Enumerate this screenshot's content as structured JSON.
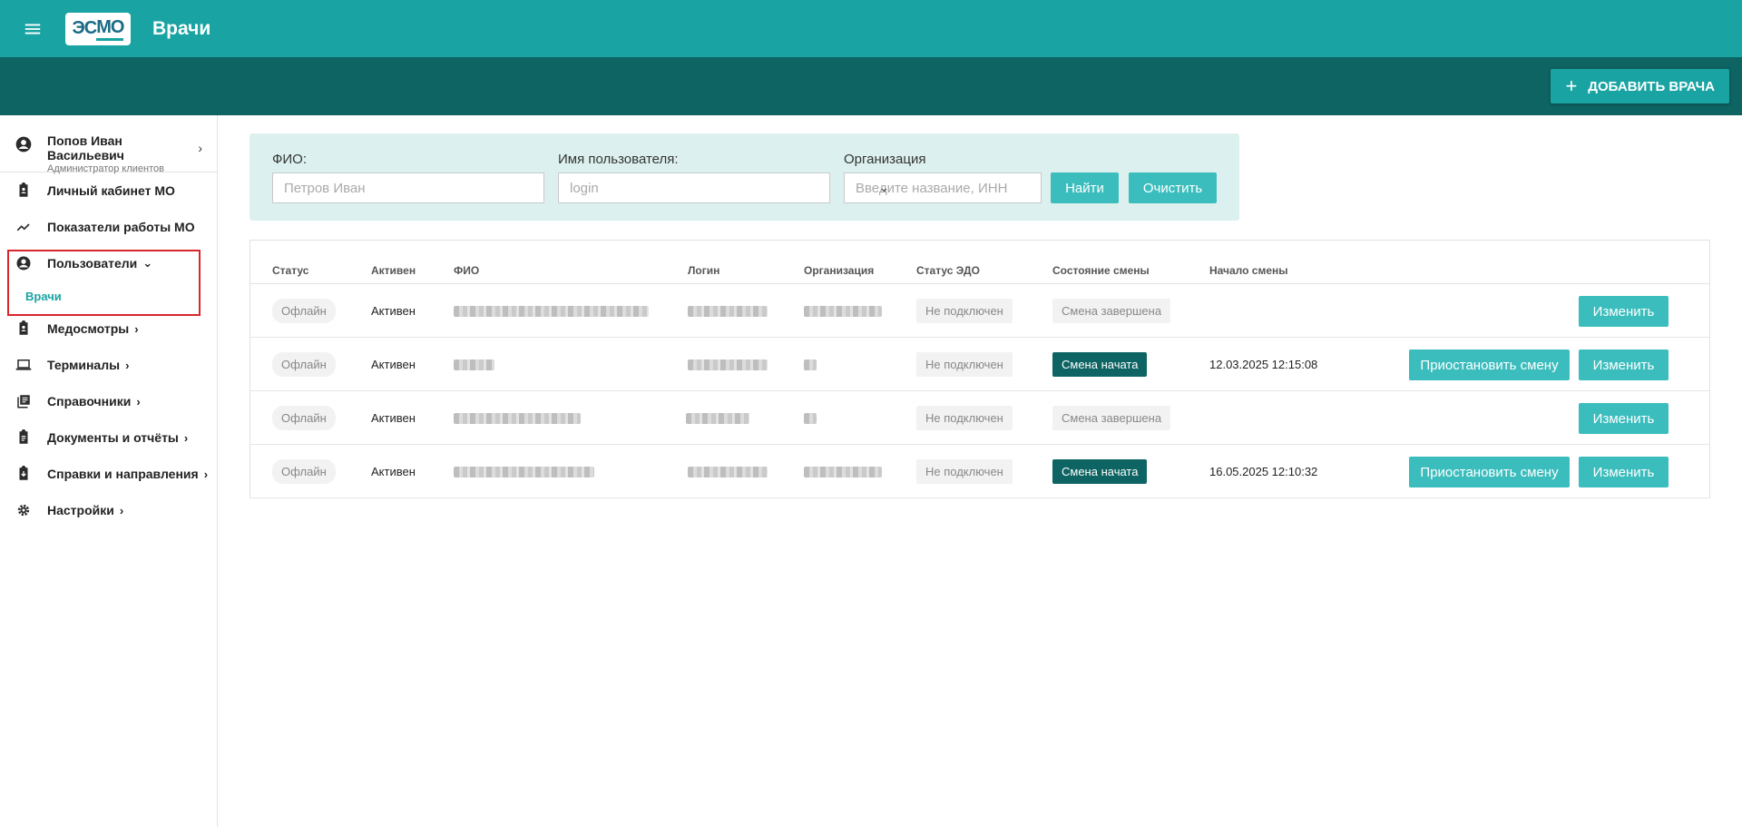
{
  "header": {
    "logo_text_a": "ЭС",
    "logo_text_b": "МО",
    "title": "Врачи",
    "add_button": "ДОБАВИТЬ ВРАЧА"
  },
  "sidebar": {
    "profile": {
      "name": "Попов Иван Васильевич",
      "role": "Администратор клиентов"
    },
    "items": [
      {
        "label": "Личный кабинет МО",
        "icon": "clipboard-icon"
      },
      {
        "label": "Показатели работы МО",
        "icon": "trend-icon"
      },
      {
        "label": "Пользователи",
        "icon": "account-icon"
      },
      {
        "label": "Медосмотры",
        "icon": "medical-clipboard-icon"
      },
      {
        "label": "Терминалы",
        "icon": "laptop-icon"
      },
      {
        "label": "Справочники",
        "icon": "library-icon"
      },
      {
        "label": "Документы и отчёты",
        "icon": "document-icon"
      },
      {
        "label": "Справки и направления",
        "icon": "download-clipboard-icon"
      },
      {
        "label": "Настройки",
        "icon": "gear-icon"
      }
    ],
    "sub_items": [
      {
        "label": "Врачи"
      }
    ]
  },
  "filters": {
    "fio_label": "ФИО:",
    "fio_placeholder": "Петров Иван",
    "login_label": "Имя пользователя:",
    "login_placeholder": "login",
    "org_label": "Организация",
    "org_placeholder": "Введите название, ИНН ...",
    "find_button": "Найти",
    "clear_button": "Очистить"
  },
  "table": {
    "columns": [
      "Статус",
      "Активен",
      "ФИО",
      "Логин",
      "Организация",
      "Статус ЭДО",
      "Состояние смены",
      "Начало смены"
    ],
    "rows": [
      {
        "status": "Офлайн",
        "active": "Активен",
        "edo": "Не подключен",
        "shift": "Смена завершена",
        "shift_start": "",
        "pause": "",
        "edit": "Изменить"
      },
      {
        "status": "Офлайн",
        "active": "Активен",
        "edo": "Не подключен",
        "shift": "Смена начата",
        "shift_start": "12.03.2025 12:15:08",
        "pause": "Приостановить смену",
        "edit": "Изменить"
      },
      {
        "status": "Офлайн",
        "active": "Активен",
        "edo": "Не подключен",
        "shift": "Смена завершена",
        "shift_start": "",
        "pause": "",
        "edit": "Изменить"
      },
      {
        "status": "Офлайн",
        "active": "Активен",
        "edo": "Не подключен",
        "shift": "Смена начата",
        "shift_start": "16.05.2025 12:10:32",
        "pause": "Приостановить смену",
        "edit": "Изменить"
      }
    ]
  },
  "colors": {
    "primary": "#19a3a3",
    "dark": "#0e6363",
    "button": "#3cbdbd",
    "highlight_border": "#d9262b"
  }
}
